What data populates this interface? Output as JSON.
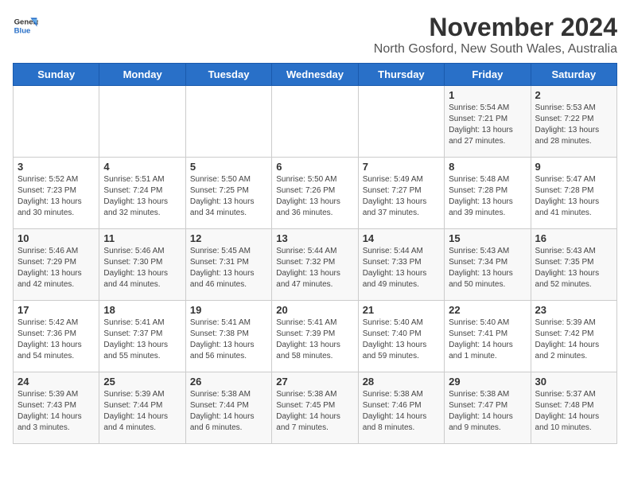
{
  "logo": {
    "text_general": "General",
    "text_blue": "Blue"
  },
  "title": "November 2024",
  "subtitle": "North Gosford, New South Wales, Australia",
  "weekdays": [
    "Sunday",
    "Monday",
    "Tuesday",
    "Wednesday",
    "Thursday",
    "Friday",
    "Saturday"
  ],
  "weeks": [
    [
      {
        "day": "",
        "info": ""
      },
      {
        "day": "",
        "info": ""
      },
      {
        "day": "",
        "info": ""
      },
      {
        "day": "",
        "info": ""
      },
      {
        "day": "",
        "info": ""
      },
      {
        "day": "1",
        "info": "Sunrise: 5:54 AM\nSunset: 7:21 PM\nDaylight: 13 hours\nand 27 minutes."
      },
      {
        "day": "2",
        "info": "Sunrise: 5:53 AM\nSunset: 7:22 PM\nDaylight: 13 hours\nand 28 minutes."
      }
    ],
    [
      {
        "day": "3",
        "info": "Sunrise: 5:52 AM\nSunset: 7:23 PM\nDaylight: 13 hours\nand 30 minutes."
      },
      {
        "day": "4",
        "info": "Sunrise: 5:51 AM\nSunset: 7:24 PM\nDaylight: 13 hours\nand 32 minutes."
      },
      {
        "day": "5",
        "info": "Sunrise: 5:50 AM\nSunset: 7:25 PM\nDaylight: 13 hours\nand 34 minutes."
      },
      {
        "day": "6",
        "info": "Sunrise: 5:50 AM\nSunset: 7:26 PM\nDaylight: 13 hours\nand 36 minutes."
      },
      {
        "day": "7",
        "info": "Sunrise: 5:49 AM\nSunset: 7:27 PM\nDaylight: 13 hours\nand 37 minutes."
      },
      {
        "day": "8",
        "info": "Sunrise: 5:48 AM\nSunset: 7:28 PM\nDaylight: 13 hours\nand 39 minutes."
      },
      {
        "day": "9",
        "info": "Sunrise: 5:47 AM\nSunset: 7:28 PM\nDaylight: 13 hours\nand 41 minutes."
      }
    ],
    [
      {
        "day": "10",
        "info": "Sunrise: 5:46 AM\nSunset: 7:29 PM\nDaylight: 13 hours\nand 42 minutes."
      },
      {
        "day": "11",
        "info": "Sunrise: 5:46 AM\nSunset: 7:30 PM\nDaylight: 13 hours\nand 44 minutes."
      },
      {
        "day": "12",
        "info": "Sunrise: 5:45 AM\nSunset: 7:31 PM\nDaylight: 13 hours\nand 46 minutes."
      },
      {
        "day": "13",
        "info": "Sunrise: 5:44 AM\nSunset: 7:32 PM\nDaylight: 13 hours\nand 47 minutes."
      },
      {
        "day": "14",
        "info": "Sunrise: 5:44 AM\nSunset: 7:33 PM\nDaylight: 13 hours\nand 49 minutes."
      },
      {
        "day": "15",
        "info": "Sunrise: 5:43 AM\nSunset: 7:34 PM\nDaylight: 13 hours\nand 50 minutes."
      },
      {
        "day": "16",
        "info": "Sunrise: 5:43 AM\nSunset: 7:35 PM\nDaylight: 13 hours\nand 52 minutes."
      }
    ],
    [
      {
        "day": "17",
        "info": "Sunrise: 5:42 AM\nSunset: 7:36 PM\nDaylight: 13 hours\nand 54 minutes."
      },
      {
        "day": "18",
        "info": "Sunrise: 5:41 AM\nSunset: 7:37 PM\nDaylight: 13 hours\nand 55 minutes."
      },
      {
        "day": "19",
        "info": "Sunrise: 5:41 AM\nSunset: 7:38 PM\nDaylight: 13 hours\nand 56 minutes."
      },
      {
        "day": "20",
        "info": "Sunrise: 5:41 AM\nSunset: 7:39 PM\nDaylight: 13 hours\nand 58 minutes."
      },
      {
        "day": "21",
        "info": "Sunrise: 5:40 AM\nSunset: 7:40 PM\nDaylight: 13 hours\nand 59 minutes."
      },
      {
        "day": "22",
        "info": "Sunrise: 5:40 AM\nSunset: 7:41 PM\nDaylight: 14 hours\nand 1 minute."
      },
      {
        "day": "23",
        "info": "Sunrise: 5:39 AM\nSunset: 7:42 PM\nDaylight: 14 hours\nand 2 minutes."
      }
    ],
    [
      {
        "day": "24",
        "info": "Sunrise: 5:39 AM\nSunset: 7:43 PM\nDaylight: 14 hours\nand 3 minutes."
      },
      {
        "day": "25",
        "info": "Sunrise: 5:39 AM\nSunset: 7:44 PM\nDaylight: 14 hours\nand 4 minutes."
      },
      {
        "day": "26",
        "info": "Sunrise: 5:38 AM\nSunset: 7:44 PM\nDaylight: 14 hours\nand 6 minutes."
      },
      {
        "day": "27",
        "info": "Sunrise: 5:38 AM\nSunset: 7:45 PM\nDaylight: 14 hours\nand 7 minutes."
      },
      {
        "day": "28",
        "info": "Sunrise: 5:38 AM\nSunset: 7:46 PM\nDaylight: 14 hours\nand 8 minutes."
      },
      {
        "day": "29",
        "info": "Sunrise: 5:38 AM\nSunset: 7:47 PM\nDaylight: 14 hours\nand 9 minutes."
      },
      {
        "day": "30",
        "info": "Sunrise: 5:37 AM\nSunset: 7:48 PM\nDaylight: 14 hours\nand 10 minutes."
      }
    ]
  ]
}
